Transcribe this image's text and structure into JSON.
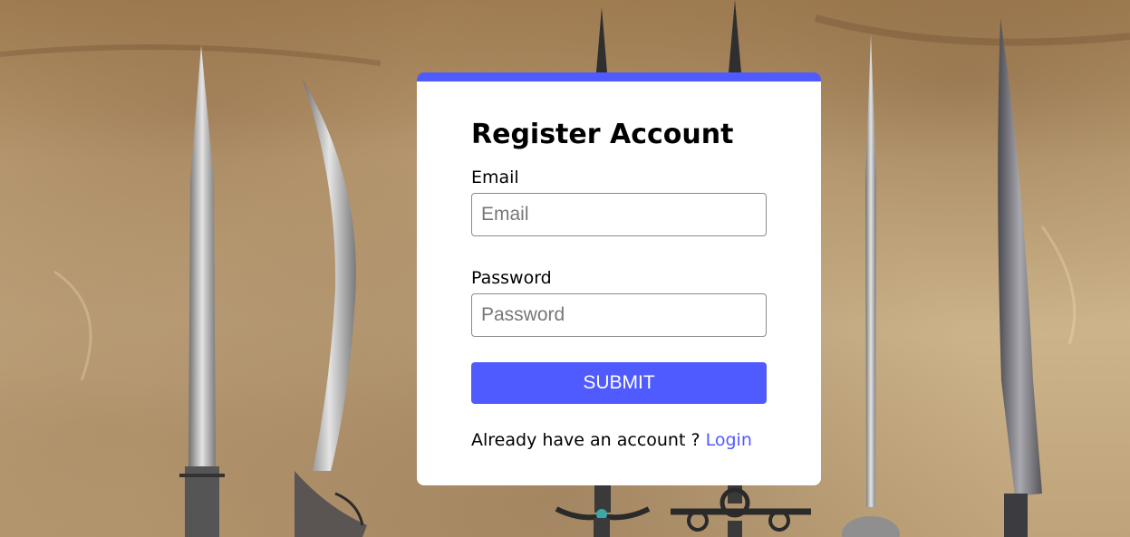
{
  "form": {
    "title": "Register Account",
    "email_label": "Email",
    "email_placeholder": "Email",
    "email_value": "",
    "password_label": "Password",
    "password_placeholder": "Password",
    "password_value": "",
    "submit_label": "SUBMIT",
    "footer_text": "Already have an account ?",
    "login_link": "Login"
  },
  "colors": {
    "accent": "#4f5bff",
    "card_bg": "#ffffff",
    "background": "#c4a77c"
  },
  "background": {
    "image": "parchment-with-swords"
  }
}
